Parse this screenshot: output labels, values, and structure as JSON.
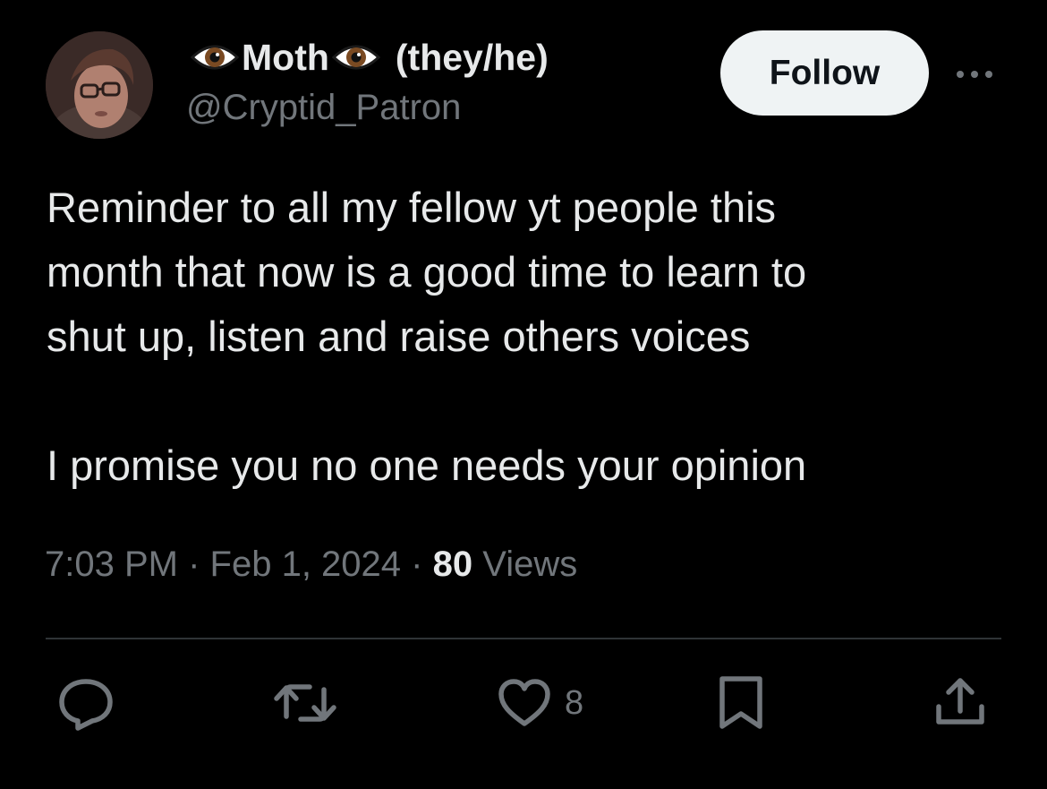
{
  "author": {
    "display_name": "Moth",
    "pronouns": "(they/he)",
    "name_emoji": "eye-emoji",
    "handle": "@Cryptid_Patron"
  },
  "header": {
    "follow_label": "Follow",
    "more_icon": "more-horizontal-icon"
  },
  "tweet": {
    "paragraph_1_line_1": "Reminder to all my fellow yt people this",
    "paragraph_1_line_2": "month that now is a good time to learn to",
    "paragraph_1_line_3": "shut up, listen and raise others voices",
    "paragraph_2": "I promise you no one needs your opinion"
  },
  "meta": {
    "time": "7:03 PM",
    "separator": "·",
    "date": "Feb 1, 2024",
    "views_count": "80",
    "views_label": "Views"
  },
  "actions": {
    "reply_icon": "reply-icon",
    "retweet_icon": "retweet-icon",
    "like_icon": "heart-icon",
    "like_count": "8",
    "bookmark_icon": "bookmark-icon",
    "share_icon": "share-icon"
  },
  "colors": {
    "background": "#000000",
    "primary_text": "#e7e9ea",
    "secondary_text": "#71767b",
    "divider": "#2f3336",
    "follow_button_bg": "#eff3f4"
  }
}
